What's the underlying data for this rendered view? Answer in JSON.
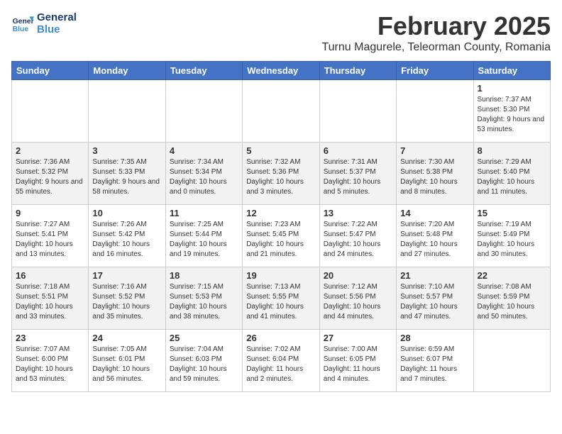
{
  "app": {
    "name_line1": "General",
    "name_line2": "Blue"
  },
  "header": {
    "month_year": "February 2025",
    "location": "Turnu Magurele, Teleorman County, Romania"
  },
  "weekdays": [
    "Sunday",
    "Monday",
    "Tuesday",
    "Wednesday",
    "Thursday",
    "Friday",
    "Saturday"
  ],
  "weeks": [
    [
      {
        "day": "",
        "info": ""
      },
      {
        "day": "",
        "info": ""
      },
      {
        "day": "",
        "info": ""
      },
      {
        "day": "",
        "info": ""
      },
      {
        "day": "",
        "info": ""
      },
      {
        "day": "",
        "info": ""
      },
      {
        "day": "1",
        "info": "Sunrise: 7:37 AM\nSunset: 5:30 PM\nDaylight: 9 hours and 53 minutes."
      }
    ],
    [
      {
        "day": "2",
        "info": "Sunrise: 7:36 AM\nSunset: 5:32 PM\nDaylight: 9 hours and 55 minutes."
      },
      {
        "day": "3",
        "info": "Sunrise: 7:35 AM\nSunset: 5:33 PM\nDaylight: 9 hours and 58 minutes."
      },
      {
        "day": "4",
        "info": "Sunrise: 7:34 AM\nSunset: 5:34 PM\nDaylight: 10 hours and 0 minutes."
      },
      {
        "day": "5",
        "info": "Sunrise: 7:32 AM\nSunset: 5:36 PM\nDaylight: 10 hours and 3 minutes."
      },
      {
        "day": "6",
        "info": "Sunrise: 7:31 AM\nSunset: 5:37 PM\nDaylight: 10 hours and 5 minutes."
      },
      {
        "day": "7",
        "info": "Sunrise: 7:30 AM\nSunset: 5:38 PM\nDaylight: 10 hours and 8 minutes."
      },
      {
        "day": "8",
        "info": "Sunrise: 7:29 AM\nSunset: 5:40 PM\nDaylight: 10 hours and 11 minutes."
      }
    ],
    [
      {
        "day": "9",
        "info": "Sunrise: 7:27 AM\nSunset: 5:41 PM\nDaylight: 10 hours and 13 minutes."
      },
      {
        "day": "10",
        "info": "Sunrise: 7:26 AM\nSunset: 5:42 PM\nDaylight: 10 hours and 16 minutes."
      },
      {
        "day": "11",
        "info": "Sunrise: 7:25 AM\nSunset: 5:44 PM\nDaylight: 10 hours and 19 minutes."
      },
      {
        "day": "12",
        "info": "Sunrise: 7:23 AM\nSunset: 5:45 PM\nDaylight: 10 hours and 21 minutes."
      },
      {
        "day": "13",
        "info": "Sunrise: 7:22 AM\nSunset: 5:47 PM\nDaylight: 10 hours and 24 minutes."
      },
      {
        "day": "14",
        "info": "Sunrise: 7:20 AM\nSunset: 5:48 PM\nDaylight: 10 hours and 27 minutes."
      },
      {
        "day": "15",
        "info": "Sunrise: 7:19 AM\nSunset: 5:49 PM\nDaylight: 10 hours and 30 minutes."
      }
    ],
    [
      {
        "day": "16",
        "info": "Sunrise: 7:18 AM\nSunset: 5:51 PM\nDaylight: 10 hours and 33 minutes."
      },
      {
        "day": "17",
        "info": "Sunrise: 7:16 AM\nSunset: 5:52 PM\nDaylight: 10 hours and 35 minutes."
      },
      {
        "day": "18",
        "info": "Sunrise: 7:15 AM\nSunset: 5:53 PM\nDaylight: 10 hours and 38 minutes."
      },
      {
        "day": "19",
        "info": "Sunrise: 7:13 AM\nSunset: 5:55 PM\nDaylight: 10 hours and 41 minutes."
      },
      {
        "day": "20",
        "info": "Sunrise: 7:12 AM\nSunset: 5:56 PM\nDaylight: 10 hours and 44 minutes."
      },
      {
        "day": "21",
        "info": "Sunrise: 7:10 AM\nSunset: 5:57 PM\nDaylight: 10 hours and 47 minutes."
      },
      {
        "day": "22",
        "info": "Sunrise: 7:08 AM\nSunset: 5:59 PM\nDaylight: 10 hours and 50 minutes."
      }
    ],
    [
      {
        "day": "23",
        "info": "Sunrise: 7:07 AM\nSunset: 6:00 PM\nDaylight: 10 hours and 53 minutes."
      },
      {
        "day": "24",
        "info": "Sunrise: 7:05 AM\nSunset: 6:01 PM\nDaylight: 10 hours and 56 minutes."
      },
      {
        "day": "25",
        "info": "Sunrise: 7:04 AM\nSunset: 6:03 PM\nDaylight: 10 hours and 59 minutes."
      },
      {
        "day": "26",
        "info": "Sunrise: 7:02 AM\nSunset: 6:04 PM\nDaylight: 11 hours and 2 minutes."
      },
      {
        "day": "27",
        "info": "Sunrise: 7:00 AM\nSunset: 6:05 PM\nDaylight: 11 hours and 4 minutes."
      },
      {
        "day": "28",
        "info": "Sunrise: 6:59 AM\nSunset: 6:07 PM\nDaylight: 11 hours and 7 minutes."
      },
      {
        "day": "",
        "info": ""
      }
    ]
  ]
}
